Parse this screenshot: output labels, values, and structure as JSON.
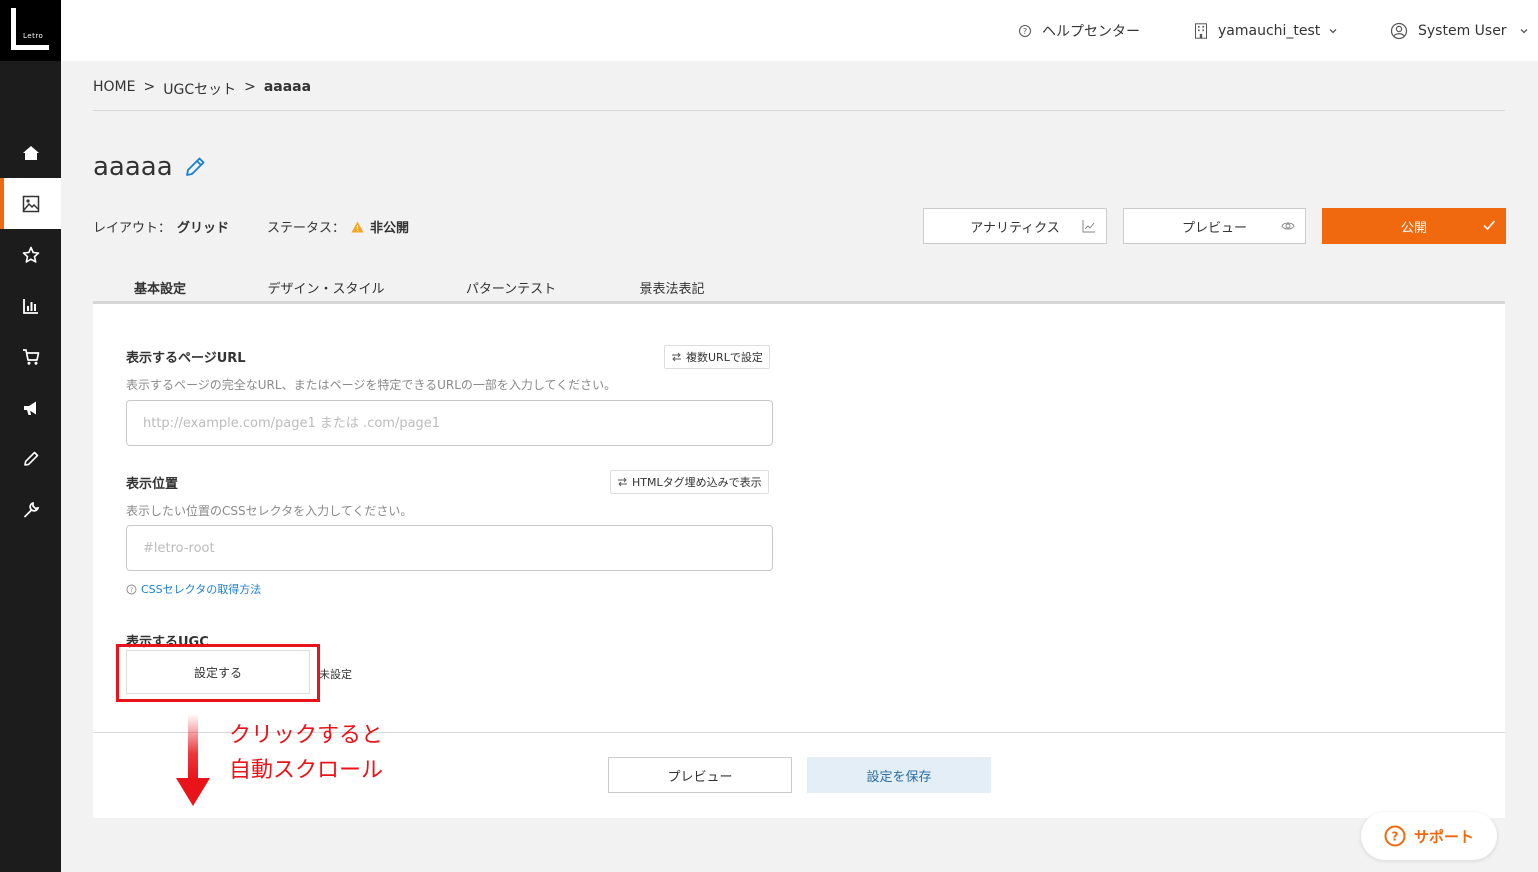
{
  "logo": {
    "text": "Letro"
  },
  "topbar": {
    "help_label": "ヘルプセンター",
    "account_label": "yamauchi_test",
    "user_label": "System User"
  },
  "sidebar": {
    "items": [
      {
        "icon": "home-icon",
        "active": false
      },
      {
        "icon": "image-icon",
        "active": true
      },
      {
        "icon": "star-icon",
        "active": false
      },
      {
        "icon": "chart-icon",
        "active": false
      },
      {
        "icon": "cart-icon",
        "active": false
      },
      {
        "icon": "megaphone-icon",
        "active": false
      },
      {
        "icon": "pencil-icon",
        "active": false
      },
      {
        "icon": "wrench-icon",
        "active": false
      }
    ]
  },
  "breadcrumb": {
    "home": "HOME",
    "sep": ">",
    "section": "UGCセット",
    "current": "aaaaa"
  },
  "page": {
    "title": "aaaaa",
    "layout_label": "レイアウト：",
    "layout_value": "グリッド",
    "status_label": "ステータス：",
    "status_value": "非公開"
  },
  "actions": {
    "analytics": "アナリティクス",
    "preview": "プレビュー",
    "publish": "公開"
  },
  "tabs": [
    {
      "label": "基本設定",
      "active": true
    },
    {
      "label": "デザイン・スタイル",
      "active": false
    },
    {
      "label": "パターンテスト",
      "active": false
    },
    {
      "label": "景表法表記",
      "active": false
    }
  ],
  "form": {
    "url": {
      "label": "表示するページURL",
      "toggle": "複数URLで設定",
      "help": "表示するページの完全なURL、またはページを特定できるURLの一部を入力してください。",
      "placeholder": "http://example.com/page1 または .com/page1",
      "value": ""
    },
    "position": {
      "label": "表示位置",
      "toggle": "HTMLタグ埋め込みで表示",
      "help": "表示したい位置のCSSセレクタを入力してください。",
      "placeholder": "#letro-root",
      "value": "",
      "help_link": "CSSセレクタの取得方法"
    },
    "ugc": {
      "label": "表示するUGC",
      "button": "設定する",
      "status": "未設定"
    }
  },
  "footer_buttons": {
    "preview": "プレビュー",
    "save": "設定を保存"
  },
  "annotation": {
    "line1": "クリックすると",
    "line2": "自動スクロール",
    "color": "#e8141a"
  },
  "support": {
    "label": "サポート"
  },
  "colors": {
    "accent": "#f0690f",
    "sidebar": "#1c1c1c",
    "annotation": "#e8141a"
  }
}
